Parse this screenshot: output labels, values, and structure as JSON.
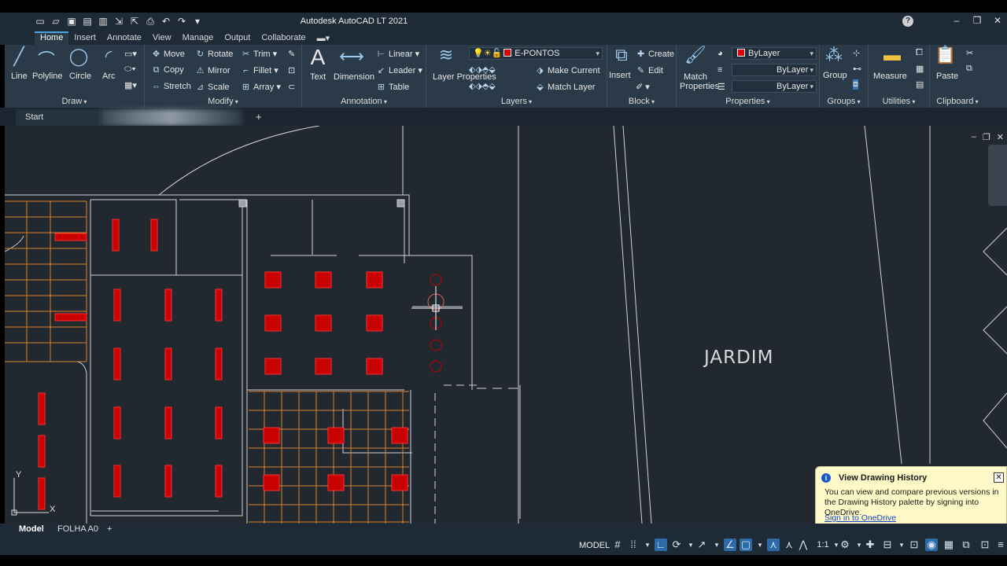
{
  "app": {
    "title": "Autodesk AutoCAD LT 2021"
  },
  "ribbon_tabs": [
    "Home",
    "Insert",
    "Annotate",
    "View",
    "Manage",
    "Output",
    "Collaborate"
  ],
  "panels": {
    "draw": {
      "label": "Draw",
      "tools": [
        "Line",
        "Polyline",
        "Circle",
        "Arc"
      ]
    },
    "modify": {
      "label": "Modify",
      "tools": [
        "Move",
        "Rotate",
        "Trim",
        "Copy",
        "Mirror",
        "Fillet",
        "Stretch",
        "Scale",
        "Array"
      ]
    },
    "annotation": {
      "label": "Annotation",
      "tools": [
        "Text",
        "Dimension",
        "Linear",
        "Leader",
        "Table"
      ]
    },
    "layers": {
      "label": "Layers",
      "layer_props": "Layer Properties",
      "current_layer": "E-PONTOS",
      "make_current": "Make Current",
      "match_layer": "Match Layer"
    },
    "block": {
      "label": "Block",
      "insert": "Insert",
      "create": "Create",
      "edit": "Edit"
    },
    "properties": {
      "label": "Properties",
      "match": "Match Properties",
      "color": "ByLayer",
      "linetype": "ByLayer",
      "lineweight": "ByLayer"
    },
    "groups": {
      "label": "Groups",
      "group": "Group"
    },
    "utilities": {
      "label": "Utilities",
      "measure": "Measure"
    },
    "clipboard": {
      "label": "Clipboard",
      "paste": "Paste"
    }
  },
  "file_tabs": {
    "start": "Start"
  },
  "canvas": {
    "room_label": "JARDIM",
    "ucs_x": "X",
    "ucs_y": "Y"
  },
  "layout_tabs": [
    "Model",
    "FOLHA A0"
  ],
  "status": {
    "model_label": "MODEL",
    "scale": "1:1"
  },
  "notification": {
    "title": "View Drawing History",
    "body": "You can view and compare previous versions in the Drawing History palette by signing into OneDrive.",
    "link": "Sign in to OneDrive"
  },
  "colors": {
    "accent": "#4aa3df",
    "layer_red": "#e00000",
    "orange_grid": "#d9822b",
    "canvas_bg": "#212830"
  }
}
